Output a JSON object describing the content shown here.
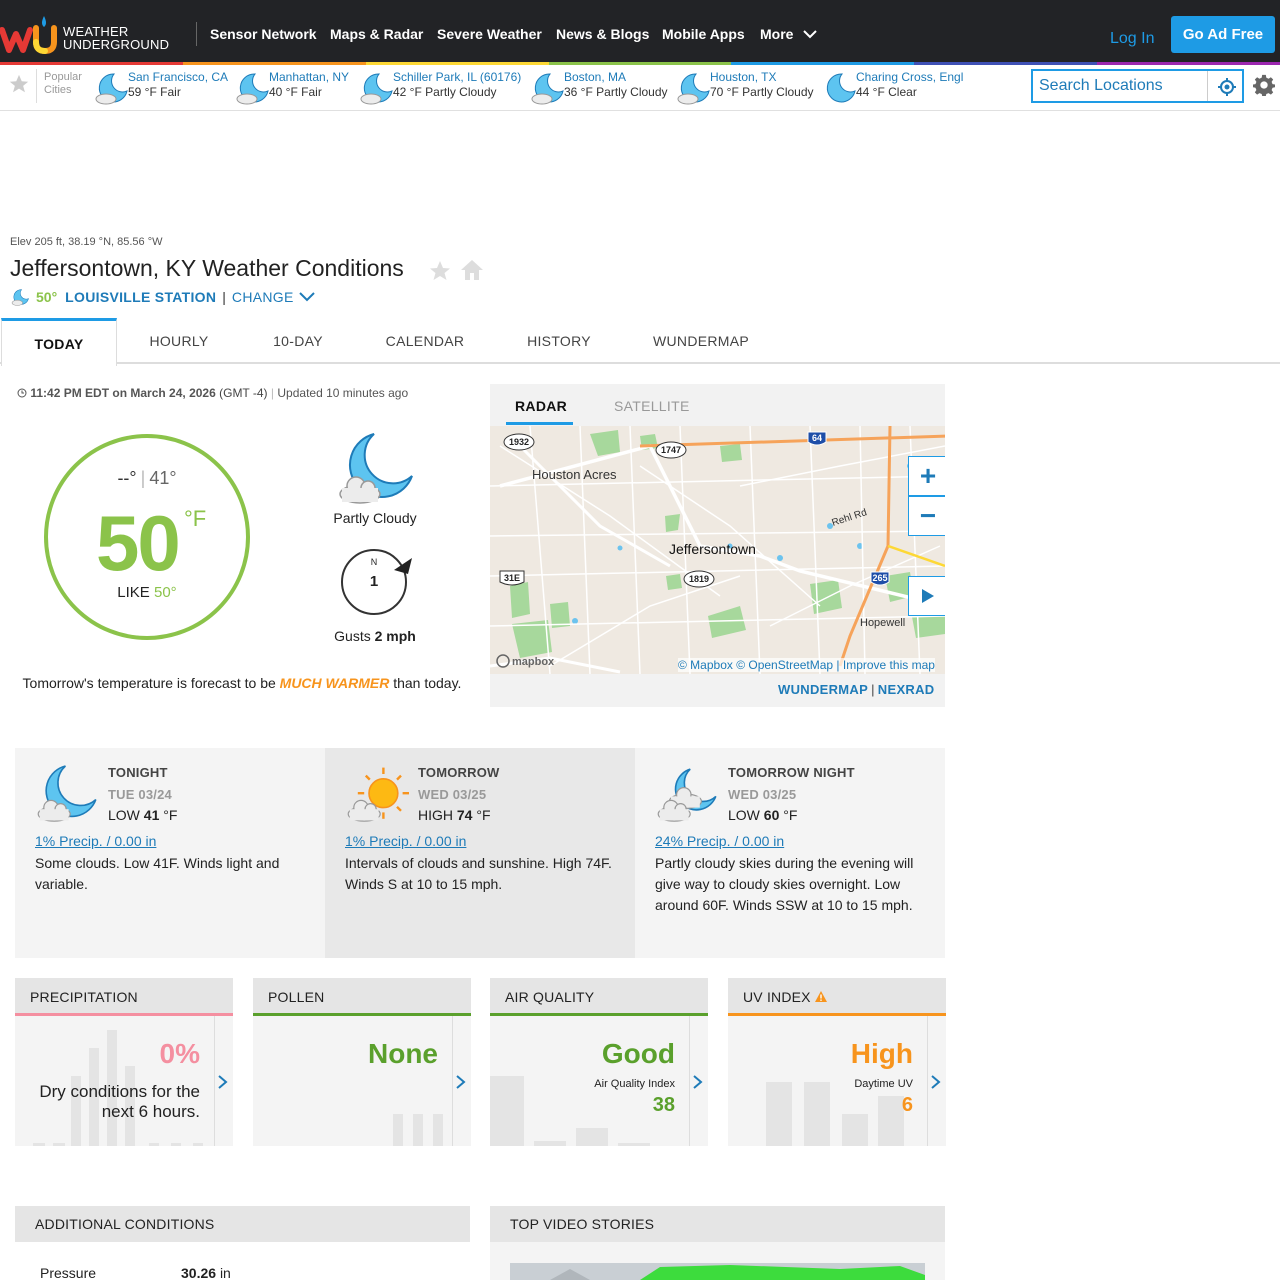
{
  "header": {
    "brand_line1": "WEATHER",
    "brand_line2": "UNDERGROUND",
    "nav": [
      "Sensor Network",
      "Maps & Radar",
      "Severe Weather",
      "News & Blogs",
      "Mobile Apps",
      "More"
    ],
    "login": "Log In",
    "ad_free": "Go Ad Free",
    "rainbow_colors": [
      "#e53935",
      "#f7941d",
      "#fdd835",
      "#8bc34a",
      "#1e9be5",
      "#3f51b5",
      "#9c27b0"
    ]
  },
  "popular": {
    "label_line1": "Popular",
    "label_line2": "Cities",
    "cities": [
      {
        "name": "San Francisco, CA",
        "wx": "59 °F Fair"
      },
      {
        "name": "Manhattan, NY",
        "wx": "40 °F Fair"
      },
      {
        "name": "Schiller Park, IL (60176)",
        "wx": "42 °F Partly Cloudy"
      },
      {
        "name": "Boston, MA",
        "wx": "36 °F Partly Cloudy"
      },
      {
        "name": "Houston, TX",
        "wx": "70 °F Partly Cloudy"
      },
      {
        "name": "Charing Cross, Engl",
        "wx": "44 °F Clear"
      }
    ],
    "search_placeholder": "Search Locations"
  },
  "location": {
    "elev": "Elev 205 ft, 38.19 °N, 85.56 °W",
    "title": "Jeffersontown, KY Weather Conditions",
    "station_temp": "50°",
    "station": "LOUISVILLE STATION",
    "pipe": "|",
    "change": "CHANGE"
  },
  "tabs": [
    "TODAY",
    "HOURLY",
    "10-DAY",
    "CALENDAR",
    "HISTORY",
    "WUNDERMAP"
  ],
  "current": {
    "time": "11:42 PM EDT on March 24, 2026",
    "tz": "(GMT -4)",
    "updated": "Updated 10 minutes ago",
    "hi": "--°",
    "hilo_sep": "|",
    "lo": "41°",
    "temp": "50",
    "unit": "°F",
    "feels_label": "LIKE",
    "feels_value": "50°",
    "condition": "Partly Cloudy",
    "wind_dir": "N",
    "wind_speed": "1",
    "gusts_label": "Gusts",
    "gusts_value": "2 mph",
    "tomorrow_pre": "Tomorrow's temperature is forecast to be",
    "tomorrow_hl": "MUCH WARMER",
    "tomorrow_post": "than today.",
    "accent_color": "#8bc34a"
  },
  "radar": {
    "tab_radar": "RADAR",
    "tab_satellite": "SATELLITE",
    "labels": {
      "houston_acres": "Houston Acres",
      "jeffersontown": "Jeffersontown",
      "rehl_rd": "Rehl Rd",
      "hopewell": "Hopewell",
      "r1932": "1932",
      "r1747": "1747",
      "r64": "64",
      "r31e": "31E",
      "r1819": "1819",
      "r265": "265",
      "mapbox": "mapbox"
    },
    "zoom_in": "+",
    "zoom_out": "−",
    "credit": "© Mapbox © OpenStreetMap | Improve this map",
    "link_wundermap": "WUNDERMAP",
    "link_sep": "|",
    "link_nexrad": "NEXRAD"
  },
  "forecast": [
    {
      "name": "TONIGHT",
      "date": "TUE 03/24",
      "label": "LOW",
      "temp": "41",
      "unit": "°F",
      "precip": "1% Precip. / 0.00 in",
      "desc": "Some clouds. Low 41F. Winds light and variable."
    },
    {
      "name": "TOMORROW",
      "date": "WED 03/25",
      "label": "HIGH",
      "temp": "74",
      "unit": "°F",
      "precip": "1% Precip. / 0.00 in",
      "desc": "Intervals of clouds and sunshine. High 74F. Winds S at 10 to 15 mph."
    },
    {
      "name": "TOMORROW NIGHT",
      "date": "WED 03/25",
      "label": "LOW",
      "temp": "60",
      "unit": "°F",
      "precip": "24% Precip. / 0.00 in",
      "desc": "Partly cloudy skies during the evening will give way to cloudy skies overnight. Low around 60F. Winds SSW at 10 to 15 mph."
    }
  ],
  "metrics": {
    "precip": {
      "title": "PRECIPITATION",
      "value": "0%",
      "desc": "Dry conditions for the next 6 hours.",
      "color": "#f48fa0"
    },
    "pollen": {
      "title": "POLLEN",
      "value": "None",
      "color": "#5aa02c"
    },
    "air": {
      "title": "AIR QUALITY",
      "value": "Good",
      "sub": "Air Quality Index",
      "num": "38",
      "color": "#5aa02c"
    },
    "uv": {
      "title": "UV INDEX",
      "value": "High",
      "sub": "Daytime UV",
      "num": "6",
      "color": "#f7941d"
    }
  },
  "additional": {
    "title": "ADDITIONAL CONDITIONS",
    "pressure_label": "Pressure",
    "pressure_value": "30.26",
    "pressure_unit": "in"
  },
  "videos": {
    "title": "TOP VIDEO STORIES"
  }
}
